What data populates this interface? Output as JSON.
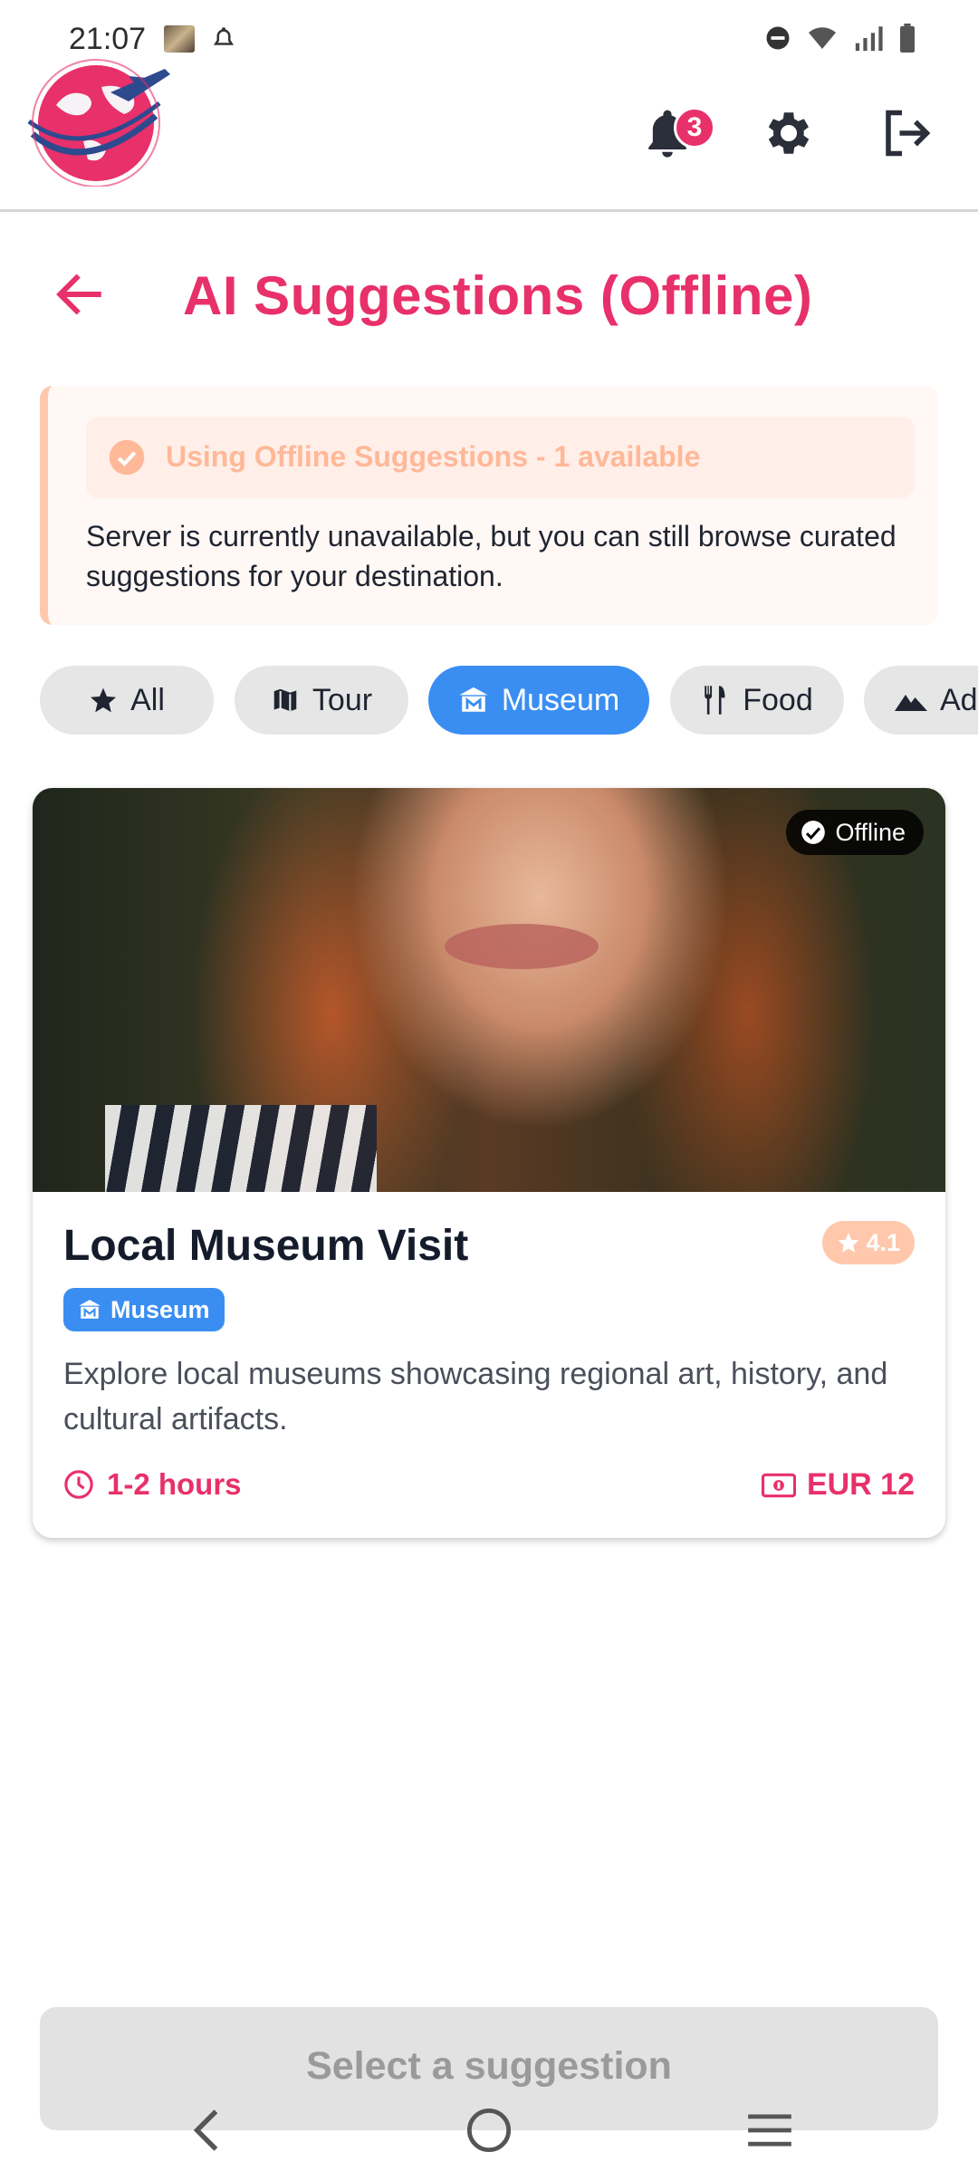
{
  "status_bar": {
    "time": "21:07"
  },
  "header": {
    "notification_count": "3",
    "icons": [
      "globe-plane-logo",
      "bell-icon",
      "gear-icon",
      "logout-icon"
    ]
  },
  "title_row": {
    "title": "AI Suggestions (Offline)"
  },
  "offline_banner": {
    "status": "Using Offline Suggestions - 1 available",
    "message": "Server is currently unavailable, but you can still browse curated suggestions for your destination."
  },
  "filters": {
    "chips": [
      {
        "label": "All",
        "icon": "star-icon"
      },
      {
        "label": "Tour",
        "icon": "map-icon"
      },
      {
        "label": "Museum",
        "icon": "museum-icon"
      },
      {
        "label": "Food",
        "icon": "fork-knife-icon"
      },
      {
        "label": "Ad",
        "icon": "mountain-icon"
      }
    ],
    "selected": "Museum"
  },
  "suggestion_card": {
    "offline_tag": "Offline",
    "title": "Local Museum Visit",
    "rating": "4.1",
    "category": "Museum",
    "description": "Explore local museums showcasing regional art, history, and cultural artifacts.",
    "duration": "1-2 hours",
    "price": "EUR 12"
  },
  "footer": {
    "select_button": "Select a suggestion"
  },
  "colors": {
    "accent": "#e8306a",
    "selected_chip": "#3a8ef2",
    "banner_accent": "#ffc8ad"
  }
}
